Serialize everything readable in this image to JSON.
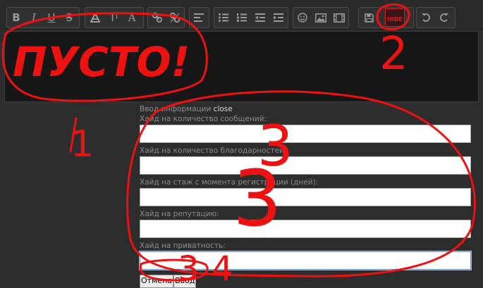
{
  "toolbar": {
    "bold": "B",
    "italic": "I",
    "underline": "U",
    "strike": "S",
    "font_color": "A",
    "font_size": "T",
    "font_size_mark": "I",
    "remove_format": "A",
    "hide_button_text": "HIDE"
  },
  "editor": {
    "content": ""
  },
  "popup": {
    "title": "Ввод информации",
    "close_label": "close",
    "fields": [
      {
        "label": "Хайд на количество сообщений:",
        "value": ""
      },
      {
        "label": "Хайд на количество благодарностей:",
        "value": ""
      },
      {
        "label": "Хайд на стаж с момента регистрации (дней):",
        "value": ""
      },
      {
        "label": "Хайд на репутацию:",
        "value": ""
      },
      {
        "label": "Хайд на приватность:",
        "value": ""
      }
    ],
    "cancel_label": "Отмена",
    "submit_label": "Ввод"
  },
  "annotations": {
    "empty_text": "ПУСТО!",
    "mark_1": "1",
    "mark_2": "2",
    "mark_3": "3",
    "mark_4": "4",
    "ink_color": "#ee1111"
  },
  "colors": {
    "background": "#2d2d2d",
    "editor_background": "#161616",
    "toolbar_icon": "#9a9a9a",
    "hide_icon": "#cc2222"
  }
}
